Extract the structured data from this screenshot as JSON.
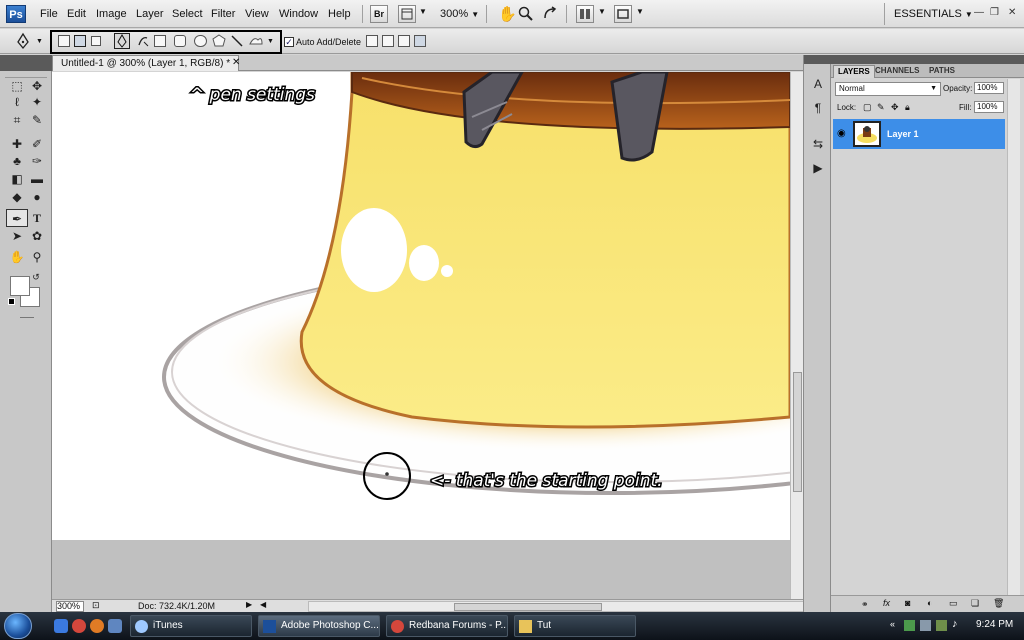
{
  "menubar": {
    "logo": "Ps",
    "items": [
      "File",
      "Edit",
      "Image",
      "Layer",
      "Select",
      "Filter",
      "View",
      "Window",
      "Help"
    ],
    "br_label": "Br",
    "zoom": "300%",
    "workspace": "ESSENTIALS"
  },
  "options_bar": {
    "auto_add_delete_label": "Auto Add/Delete",
    "auto_add_delete_checked": true
  },
  "document": {
    "tab_title": "Untitled-1 @ 300% (Layer 1, RGB/8) *",
    "status_zoom": "300%",
    "status_doc": "Doc: 732.4K/1.20M"
  },
  "annotations": {
    "pen_settings": "^ pen settings",
    "starting_point": "<- that's the starting point."
  },
  "layers_panel": {
    "tabs": [
      "LAYERS",
      "CHANNELS",
      "PATHS"
    ],
    "active_tab": "LAYERS",
    "blend_mode": "Normal",
    "opacity_label": "Opacity:",
    "opacity": "100%",
    "lock_label": "Lock:",
    "fill_label": "Fill:",
    "fill": "100%",
    "layer_name": "Layer 1"
  },
  "taskbar": {
    "tasks": [
      "iTunes",
      "Adobe Photoshop C...",
      "Redbana Forums - P...",
      "Tut"
    ],
    "active_task": "Adobe Photoshop C...",
    "clock": "9:24 PM"
  },
  "colors": {
    "layer_selected": "#3d8ee8",
    "pudding": "#f6e47a",
    "caramel": "#7a3a12"
  }
}
